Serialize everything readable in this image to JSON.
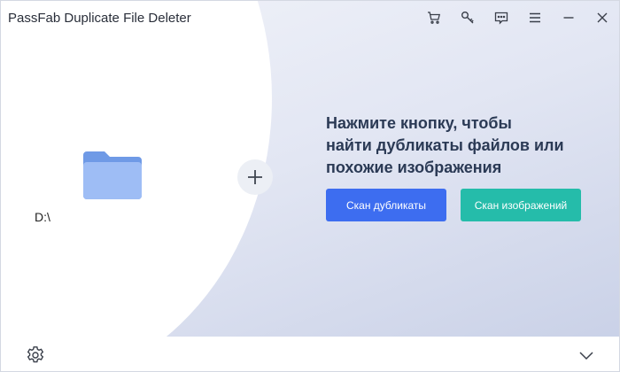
{
  "app": {
    "title": "PassFab Duplicate File Deleter"
  },
  "title_bar": {
    "buttons": [
      {
        "name": "cart-icon"
      },
      {
        "name": "key-icon"
      },
      {
        "name": "feedback-icon"
      },
      {
        "name": "menu-icon"
      },
      {
        "name": "minimize-icon"
      },
      {
        "name": "close-icon"
      }
    ]
  },
  "folder": {
    "path": "D:\\",
    "icon": "folder-icon"
  },
  "add": {
    "icon": "plus-icon"
  },
  "main": {
    "headline_lines": [
      "Нажмите кнопку, чтобы",
      "найти дубликаты файлов или",
      "похожие изображения"
    ],
    "scan_duplicates_label": "Скан дубликаты",
    "scan_images_label": "Скан изображений"
  },
  "colors": {
    "primary": "#3d6df0",
    "secondary": "#25bcaa",
    "headline": "#2b3a55",
    "folder": "#8fb2f2"
  },
  "footer": {
    "settings_icon": "gear-icon",
    "expand_icon": "chevron-down-icon"
  }
}
